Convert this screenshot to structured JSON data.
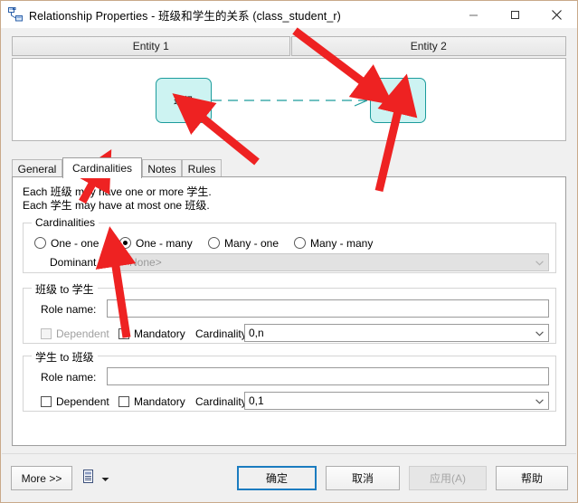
{
  "window": {
    "icon": "relationship-icon",
    "title": "Relationship Properties - 班级和学生的关系 (class_student_r)",
    "minimize_label": "Minimize",
    "maximize_label": "Maximize",
    "close_label": "Close"
  },
  "entity_headers": {
    "entity1": "Entity 1",
    "entity2": "Entity 2"
  },
  "diagram": {
    "left_entity": "班级",
    "right_entity": "学生",
    "entity_fill": "#cdf3f2",
    "entity_border": "#1c9c9c",
    "link_color": "#1c9c9c",
    "link_style": "dashed"
  },
  "tabs": [
    {
      "label": "General",
      "active": false
    },
    {
      "label": "Cardinalities",
      "active": true
    },
    {
      "label": "Notes",
      "active": false
    },
    {
      "label": "Rules",
      "active": false
    }
  ],
  "description": {
    "line1": "Each 班级 may have one or more 学生.",
    "line2": "Each 学生 may have at most one 班级."
  },
  "cardinalities_group": {
    "title": "Cardinalities",
    "options": [
      {
        "label": "One - one",
        "checked": false
      },
      {
        "label": "One - many",
        "checked": true
      },
      {
        "label": "Many - one",
        "checked": false
      },
      {
        "label": "Many - many",
        "checked": false
      }
    ],
    "dominant_role_label": "Dominant role:",
    "dominant_role_value": "<None>",
    "dominant_role_disabled": true
  },
  "group_a_to_b": {
    "title": "班级 to 学生",
    "role_name_label": "Role name:",
    "role_name_value": "",
    "role_name_placeholder": "",
    "dependent_label": "Dependent",
    "dependent_checked": false,
    "dependent_disabled": true,
    "mandatory_label": "Mandatory",
    "mandatory_checked": false,
    "cardinality_label": "Cardinality:",
    "cardinality_value": "0,n"
  },
  "group_b_to_a": {
    "title": "学生 to 班级",
    "role_name_label": "Role name:",
    "role_name_value": "",
    "role_name_placeholder": "",
    "dependent_label": "Dependent",
    "dependent_checked": false,
    "dependent_disabled": false,
    "mandatory_label": "Mandatory",
    "mandatory_checked": false,
    "cardinality_label": "Cardinality:",
    "cardinality_value": "0,1"
  },
  "footer": {
    "more_label": "More >>",
    "list_icon": "document-list-icon",
    "dropdown_icon": "caret-down-icon",
    "ok_label": "确定",
    "cancel_label": "取消",
    "apply_label": "应用(A)",
    "apply_disabled": true,
    "help_label": "帮助"
  },
  "annotations": {
    "arrow_color": "#ee2222",
    "count": 4
  }
}
